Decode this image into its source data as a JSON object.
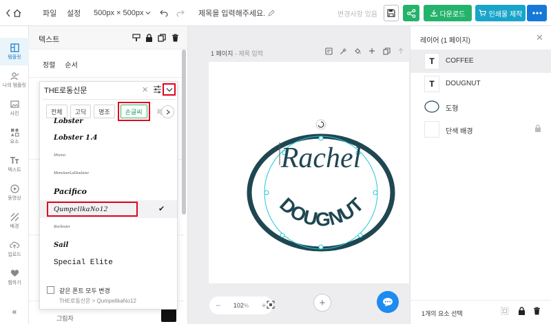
{
  "topbar": {
    "menu_file": "파일",
    "menu_settings": "설정",
    "size": "500px × 500px",
    "title_placeholder": "제목을 입력해주세요.",
    "status": "변경사항 있음",
    "download_label": "다운로드",
    "print_label": "인쇄물 제작"
  },
  "rail": {
    "items": [
      {
        "label": "템플릿",
        "icon": "template-icon"
      },
      {
        "label": "나의 템플릿",
        "icon": "my-template-icon"
      },
      {
        "label": "사진",
        "icon": "photo-icon"
      },
      {
        "label": "요소",
        "icon": "elements-icon"
      },
      {
        "label": "텍스트",
        "icon": "text-icon"
      },
      {
        "label": "동영상",
        "icon": "video-icon"
      },
      {
        "label": "배경",
        "icon": "background-icon"
      },
      {
        "label": "업로드",
        "icon": "upload-icon"
      },
      {
        "label": "찜하기",
        "icon": "heart-icon"
      }
    ],
    "collapse": "«"
  },
  "text_panel": {
    "title": "텍스트",
    "align_tab": "정렬",
    "order_tab": "순서",
    "bg_label": "그림자"
  },
  "font_dropdown": {
    "current_font": "THE로동신문",
    "categories": [
      "전체",
      "고딕",
      "명조",
      "손글씨",
      "제"
    ],
    "selected_category": "손글씨",
    "fonts": [
      {
        "name": "Lobster",
        "style": "lobster"
      },
      {
        "name": "Lobster 1.4",
        "style": "lobster14"
      },
      {
        "name": "Miama",
        "style": "tiny"
      },
      {
        "name": "MonsieurLaDoulaise",
        "style": "tiny"
      },
      {
        "name": "Pacifico",
        "style": "pacifico"
      },
      {
        "name": "QumpellkaNo12",
        "style": "qumpel",
        "selected": true
      },
      {
        "name": "Rochester",
        "style": "tiny2"
      },
      {
        "name": "Sail",
        "style": "sail"
      },
      {
        "name": "Special Elite",
        "style": "elite"
      }
    ],
    "same_font_label": "같은 폰트 모두 변경",
    "same_font_sub": "THE로동신문 > QumpellkaNo12"
  },
  "canvas": {
    "page_label": "1 페이지",
    "page_title": "- 제목 입력",
    "zoom": "102",
    "zoom_unit": "%",
    "artwork": {
      "line1": "Rachel",
      "line2": "DOUGNUT",
      "color": "#1f4752",
      "selection_color": "#23c6d6"
    }
  },
  "layers": {
    "title": "레이어 (1 페이지)",
    "items": [
      {
        "name": "COFFEE",
        "type": "text",
        "active": true
      },
      {
        "name": "DOUGNUT",
        "type": "text",
        "active": false
      },
      {
        "name": "도형",
        "type": "shape",
        "active": false
      },
      {
        "name": "단색 배경",
        "type": "background",
        "active": false,
        "locked": true
      }
    ],
    "selection_count": "1개의 요소 선택"
  }
}
